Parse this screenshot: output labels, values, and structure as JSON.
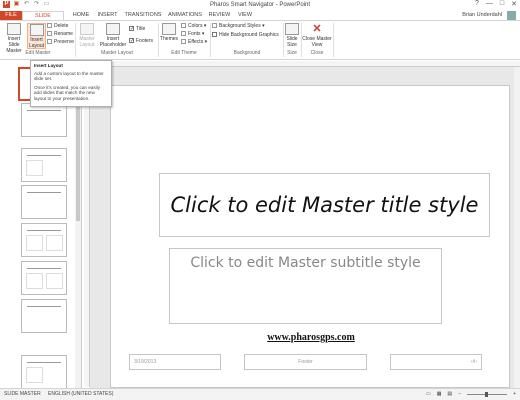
{
  "window": {
    "title": "Pharos Smart Navigator - PowerPoint",
    "controls": [
      "?",
      "—",
      "□",
      "✕"
    ]
  },
  "tabs": {
    "file": "FILE",
    "slide_master": "SLIDE MASTER",
    "home": "HOME",
    "insert": "INSERT",
    "transitions": "TRANSITIONS",
    "animations": "ANIMATIONS",
    "review": "REVIEW",
    "view": "VIEW"
  },
  "user": {
    "name": "Brian Underdahl"
  },
  "ribbon": {
    "insert_slide_master": "Insert Slide Master",
    "insert_layout": "Insert Layout",
    "delete": "Delete",
    "rename": "Rename",
    "preserve": "Preserve",
    "master_layout": "Master Layout",
    "insert_placeholder": "Insert Placeholder",
    "title_check": "Title",
    "footers_check": "Footers",
    "themes": "Themes",
    "colors": "Colors",
    "fonts": "Fonts",
    "effects": "Effects",
    "background_styles": "Background Styles",
    "hide_background_graphics": "Hide Background Graphics",
    "slide_size": "Slide Size",
    "close_master_view": "Close Master View",
    "groups": {
      "edit_master": "Edit Master",
      "master_layout": "Master Layout",
      "edit_theme": "Edit Theme",
      "background": "Background",
      "size": "Size",
      "close": "Close"
    }
  },
  "tooltip": {
    "title": "Insert Layout",
    "line1": "Add a custom layout to the master slide set.",
    "line2": "Once it's created, you can easily add slides that match the new layout to your presentation."
  },
  "slide": {
    "title_placeholder": "Click to edit Master title style",
    "subtitle_placeholder": "Click to edit Master subtitle style",
    "website": "www.pharosgps.com",
    "date": "3/19/2013",
    "footer": "Footer",
    "page_number": "‹#›"
  },
  "statusbar": {
    "view": "SLIDE MASTER",
    "language": "ENGLISH (UNITED STATES)"
  }
}
